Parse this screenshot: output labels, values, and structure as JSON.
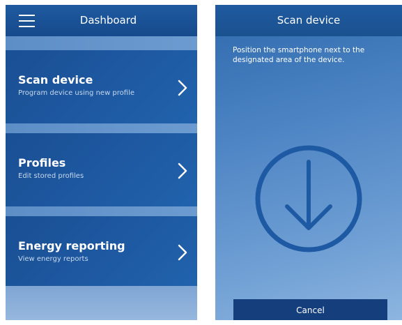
{
  "dashboard": {
    "title": "Dashboard",
    "menu_icon": "hamburger-menu-icon",
    "items": [
      {
        "title": "Scan device",
        "subtitle": "Program device using new profile",
        "icon": "chevron-right-icon"
      },
      {
        "title": "Profiles",
        "subtitle": "Edit stored profiles",
        "icon": "chevron-right-icon"
      },
      {
        "title": "Energy reporting",
        "subtitle": "View energy reports",
        "icon": "chevron-right-icon"
      }
    ]
  },
  "scan": {
    "title": "Scan device",
    "instruction": "Position the smartphone next to the designated area of the device.",
    "icon": "download-arrow-circle-icon",
    "cancel_label": "Cancel"
  },
  "colors": {
    "header": "#1f5aa0",
    "card": "#1e5aa3",
    "cancel_button": "#153f7c",
    "icon_stroke": "#1e5aa3"
  }
}
